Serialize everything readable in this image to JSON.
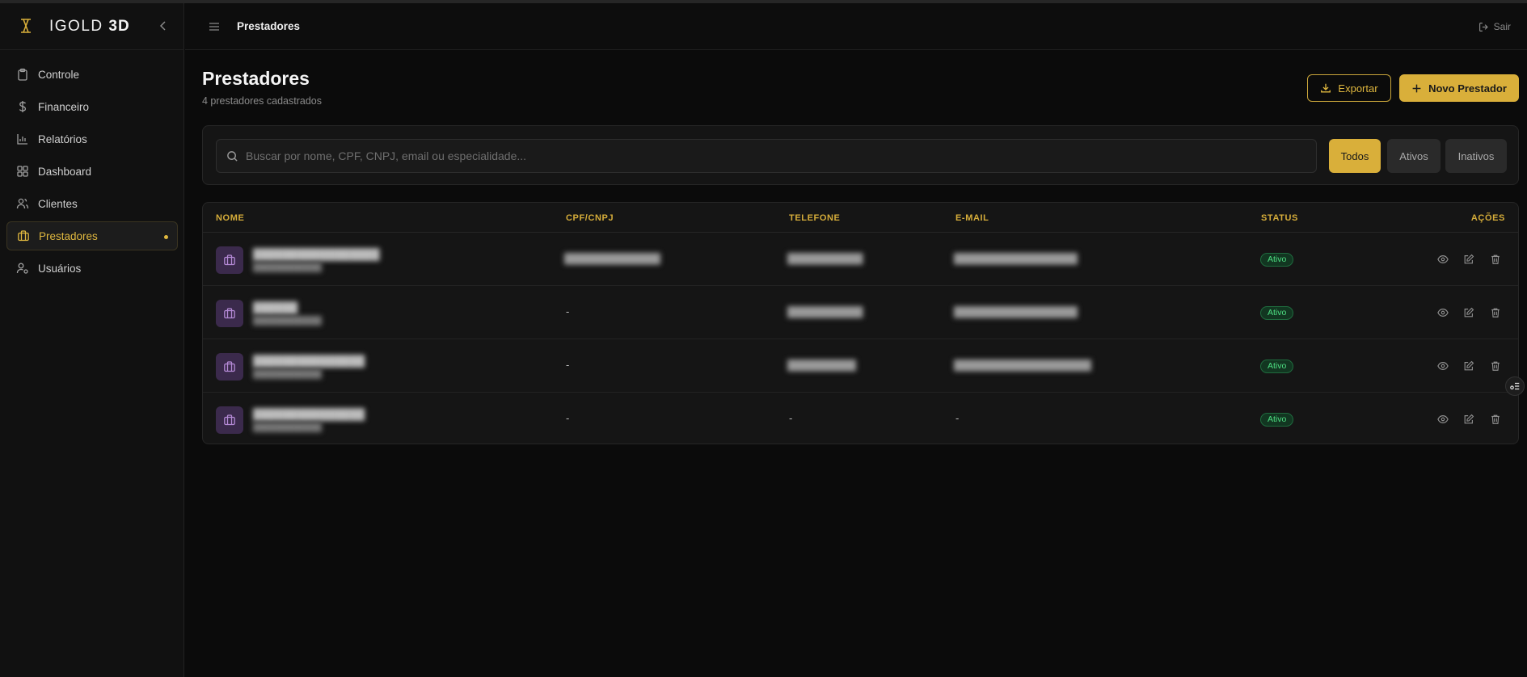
{
  "brand": {
    "name_light": "IGOLD",
    "name_bold": "3D"
  },
  "sidebar": {
    "items": [
      {
        "label": "Controle",
        "icon": "clipboard-icon"
      },
      {
        "label": "Financeiro",
        "icon": "dollar-icon"
      },
      {
        "label": "Relatórios",
        "icon": "bar-chart-icon"
      },
      {
        "label": "Dashboard",
        "icon": "grid-icon"
      },
      {
        "label": "Clientes",
        "icon": "users-icon"
      },
      {
        "label": "Prestadores",
        "icon": "briefcase-icon",
        "active": true
      },
      {
        "label": "Usuários",
        "icon": "user-cog-icon"
      }
    ]
  },
  "header": {
    "breadcrumb": "Prestadores",
    "logout_label": "Sair"
  },
  "page": {
    "title": "Prestadores",
    "subtitle": "4 prestadores cadastrados",
    "export_label": "Exportar",
    "new_label": "Novo Prestador"
  },
  "search": {
    "placeholder": "Buscar por nome, CPF, CNPJ, email ou especialidade..."
  },
  "filters": {
    "all": "Todos",
    "active": "Ativos",
    "inactive": "Inativos"
  },
  "table": {
    "columns": {
      "name": "NOME",
      "doc": "CPF/CNPJ",
      "phone": "TELEFONE",
      "email": "E-MAIL",
      "status": "STATUS",
      "actions": "AÇÕES"
    },
    "rows": [
      {
        "name": "█████████████████",
        "doc": "██████████████",
        "phone": "███████████",
        "email": "██████████████████",
        "status": "Ativo"
      },
      {
        "name": "██████",
        "doc": "-",
        "phone": "███████████",
        "email": "██████████████████",
        "status": "Ativo"
      },
      {
        "name": "███████████████",
        "doc": "-",
        "phone": "██████████",
        "email": "████████████████████",
        "status": "Ativo"
      },
      {
        "name": "███████████████",
        "doc": "-",
        "phone": "-",
        "email": "-",
        "status": "Ativo"
      }
    ]
  },
  "colors": {
    "accent": "#d9af3a",
    "success": "#4ee083",
    "avatar_bg": "#3b2a4c"
  }
}
